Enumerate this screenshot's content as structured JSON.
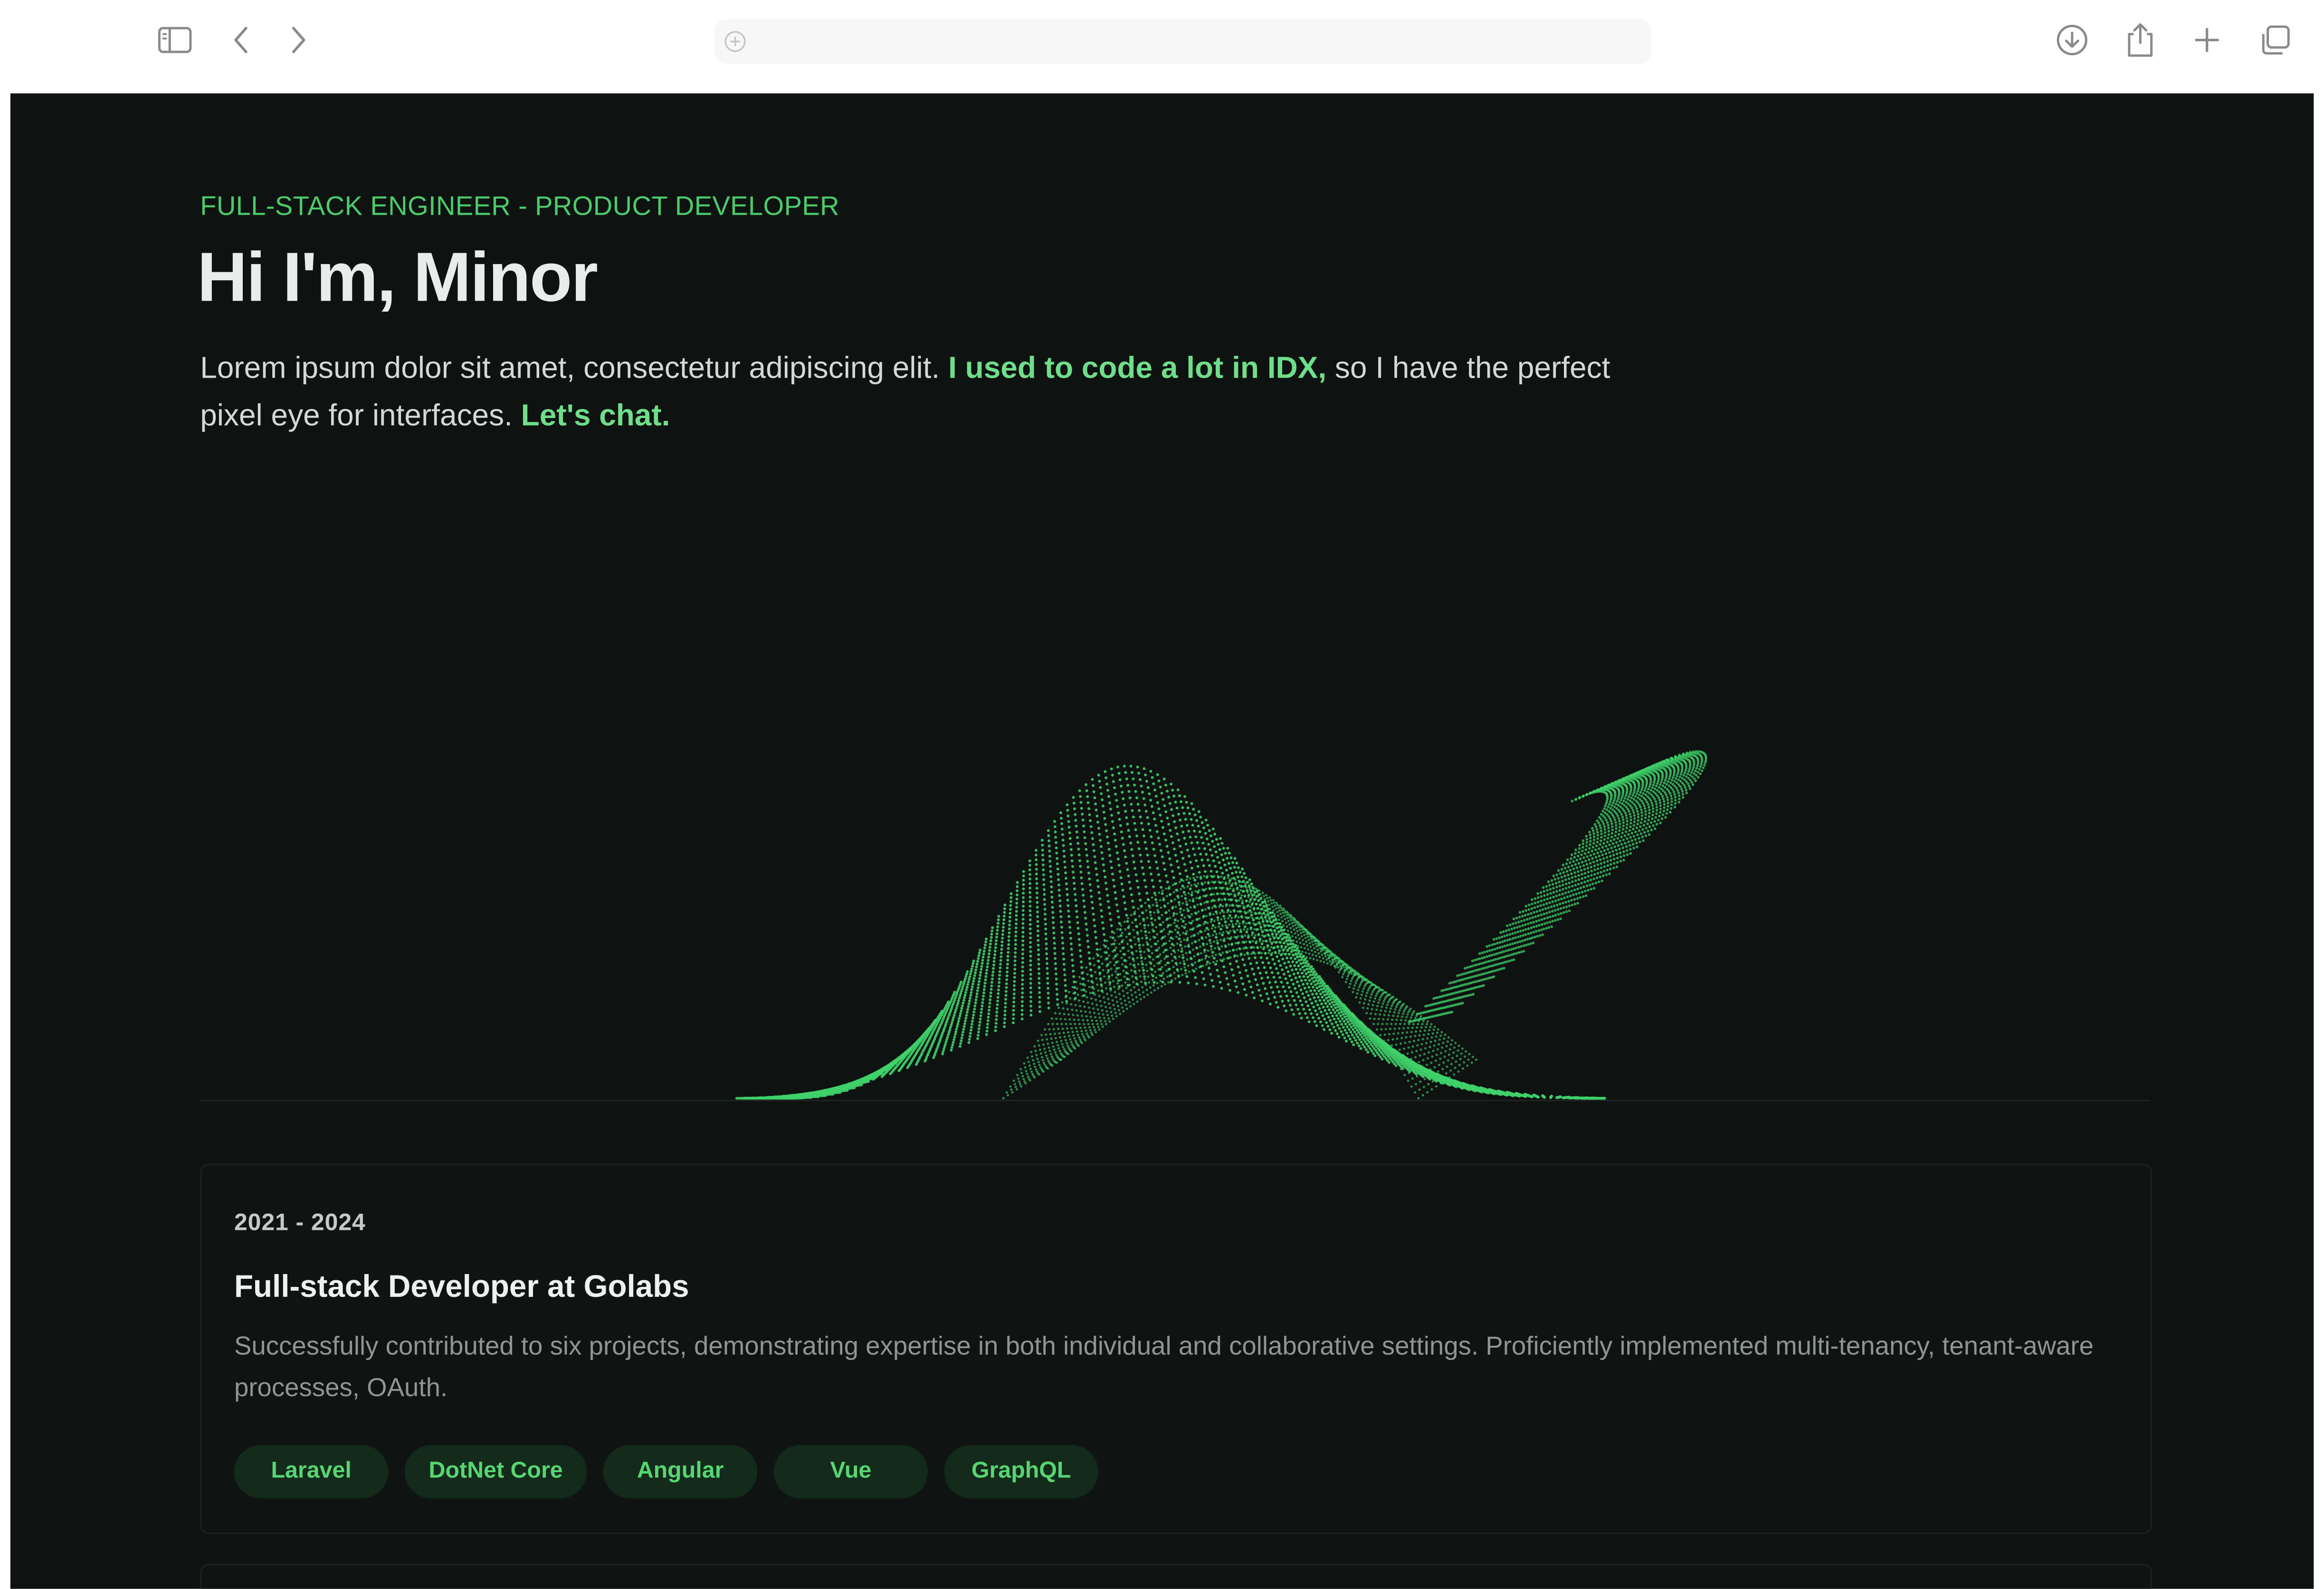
{
  "browser": {
    "icons": {
      "sidebar": "sidebar-icon",
      "back": "chevron-left-icon",
      "forward": "chevron-right-icon",
      "address": "plus-circle-icon",
      "download": "download-icon",
      "share": "share-icon",
      "new_tab": "plus-icon",
      "tabs": "tabs-overview-icon"
    },
    "address_value": ""
  },
  "hero": {
    "eyebrow": "FULL-STACK ENGINEER - PRODUCT DEVELOPER",
    "title": "Hi I'm, Minor",
    "text_part1": "Lorem ipsum dolor sit amet, consectetur adipiscing elit. ",
    "text_link1": "I used to code a lot in IDX,",
    "text_part2": " so I have the perfect pixel eye for interfaces. ",
    "text_link2": "Let's chat."
  },
  "experience": [
    {
      "date": "2021 - 2024",
      "title": "Full-stack Developer at Golabs",
      "description": "Successfully contributed to six projects, demonstrating expertise in both individual and collaborative settings. Proficiently implemented multi-tenancy, tenant-aware processes, OAuth.",
      "tags": [
        "Laravel",
        "DotNet Core",
        "Angular",
        "Vue",
        "GraphQL"
      ]
    }
  ],
  "colors": {
    "accent": "#4ccb6a",
    "background": "#0e1211",
    "tag_bg": "#142a1b",
    "wave": "#3fd06a"
  }
}
